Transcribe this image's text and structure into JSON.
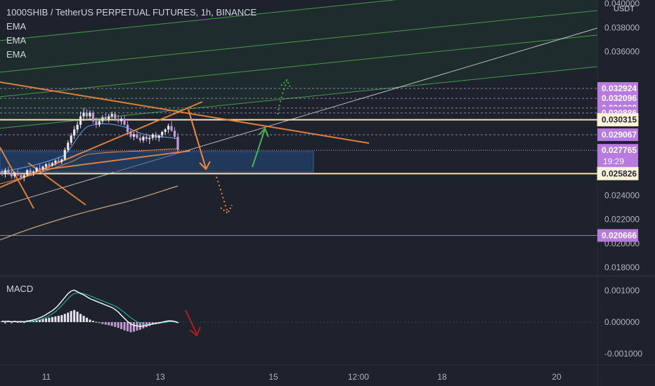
{
  "header": {
    "symbol_title": "1000SHIB / TetherUS PERPETUAL FUTURES, 1h, BINANCE",
    "indicators": [
      "EMA",
      "EMA",
      "EMA"
    ],
    "currency": "USDT"
  },
  "colors": {
    "background": "#1e222d",
    "up_candle": "#e8e8f0",
    "down_candle": "#c39bd3",
    "trendline": "#f0883e",
    "support_line": "#ffe0a6",
    "purple_label": "#b97ae0",
    "green_arrow": "#4caf50",
    "red_arrow": "#b71c1c",
    "zone_fill": "#234a80"
  },
  "chart_data": [
    {
      "type": "line",
      "title": "1000SHIB / TetherUS PERPETUAL FUTURES, 1h, BINANCE",
      "y_axis": {
        "ticks": [
          "0.040000",
          "0.038000",
          "0.036000",
          "0.024000",
          "0.022000",
          "0.020000",
          "0.018000"
        ],
        "range": [
          0.0173,
          0.0403
        ]
      },
      "x_axis": {
        "ticks": [
          "11",
          "13",
          "15",
          "12:00",
          "18",
          "20"
        ]
      },
      "price_labels": [
        {
          "value": "0.032924",
          "kind": "purple"
        },
        {
          "value": "0.032096",
          "kind": "purple"
        },
        {
          "value": "0.031292",
          "kind": "purple"
        },
        {
          "value": "0.030886",
          "kind": "purple"
        },
        {
          "value": "0.030315",
          "kind": "support"
        },
        {
          "value": "0.029067",
          "kind": "purple"
        },
        {
          "value": "0.027765",
          "countdown": "19:29",
          "kind": "current"
        },
        {
          "value": "0.025826",
          "kind": "support"
        },
        {
          "value": "0.020666",
          "kind": "purple"
        }
      ],
      "candles": [
        [
          0.026,
          0.0262,
          0.0256,
          0.0258
        ],
        [
          0.0258,
          0.0263,
          0.0255,
          0.0261
        ],
        [
          0.0261,
          0.0264,
          0.0257,
          0.0259
        ],
        [
          0.0259,
          0.0261,
          0.0254,
          0.0256
        ],
        [
          0.0256,
          0.026,
          0.0254,
          0.0259
        ],
        [
          0.0259,
          0.0262,
          0.0256,
          0.0257
        ],
        [
          0.0257,
          0.0259,
          0.0253,
          0.0255
        ],
        [
          0.0255,
          0.0258,
          0.0252,
          0.0257
        ],
        [
          0.0257,
          0.0262,
          0.0256,
          0.0261
        ],
        [
          0.0261,
          0.0263,
          0.0258,
          0.0259
        ],
        [
          0.0259,
          0.0261,
          0.0256,
          0.026
        ],
        [
          0.026,
          0.0264,
          0.0259,
          0.0263
        ],
        [
          0.0263,
          0.0266,
          0.0261,
          0.0262
        ],
        [
          0.0262,
          0.0265,
          0.026,
          0.0264
        ],
        [
          0.0264,
          0.0267,
          0.0262,
          0.0266
        ],
        [
          0.0266,
          0.0268,
          0.0263,
          0.0265
        ],
        [
          0.0265,
          0.0268,
          0.0264,
          0.0267
        ],
        [
          0.0267,
          0.027,
          0.0265,
          0.0269
        ],
        [
          0.0269,
          0.0272,
          0.0267,
          0.0268
        ],
        [
          0.0268,
          0.0271,
          0.0266,
          0.027
        ],
        [
          0.027,
          0.028,
          0.0269,
          0.0278
        ],
        [
          0.0278,
          0.0286,
          0.0276,
          0.0284
        ],
        [
          0.0284,
          0.0292,
          0.0282,
          0.029
        ],
        [
          0.029,
          0.0298,
          0.0287,
          0.0295
        ],
        [
          0.0295,
          0.0302,
          0.0292,
          0.0299
        ],
        [
          0.0299,
          0.031,
          0.0296,
          0.0306
        ],
        [
          0.0306,
          0.0313,
          0.0302,
          0.0309
        ],
        [
          0.0309,
          0.0312,
          0.0304,
          0.0306
        ],
        [
          0.0306,
          0.0311,
          0.0303,
          0.0309
        ],
        [
          0.0309,
          0.0311,
          0.03,
          0.0302
        ],
        [
          0.0302,
          0.0305,
          0.0296,
          0.0299
        ],
        [
          0.0299,
          0.0304,
          0.0297,
          0.0302
        ],
        [
          0.0302,
          0.0307,
          0.03,
          0.0305
        ],
        [
          0.0305,
          0.0309,
          0.0302,
          0.0303
        ],
        [
          0.0303,
          0.0308,
          0.0301,
          0.0306
        ],
        [
          0.0306,
          0.031,
          0.0304,
          0.0308
        ],
        [
          0.0308,
          0.031,
          0.0302,
          0.0304
        ],
        [
          0.0304,
          0.0307,
          0.03,
          0.0302
        ],
        [
          0.0302,
          0.0306,
          0.0299,
          0.0304
        ],
        [
          0.0304,
          0.0307,
          0.0298,
          0.0299
        ],
        [
          0.0299,
          0.0302,
          0.0291,
          0.0293
        ],
        [
          0.0293,
          0.0296,
          0.0287,
          0.0289
        ],
        [
          0.0289,
          0.0293,
          0.0286,
          0.0291
        ],
        [
          0.0291,
          0.0294,
          0.0287,
          0.0288
        ],
        [
          0.0288,
          0.0291,
          0.0284,
          0.0286
        ],
        [
          0.0286,
          0.029,
          0.0284,
          0.0289
        ],
        [
          0.0289,
          0.0292,
          0.0285,
          0.0287
        ],
        [
          0.0287,
          0.029,
          0.0283,
          0.0288
        ],
        [
          0.0288,
          0.0292,
          0.0286,
          0.0291
        ],
        [
          0.0291,
          0.0293,
          0.0286,
          0.0288
        ],
        [
          0.0288,
          0.0291,
          0.0285,
          0.029
        ],
        [
          0.029,
          0.0294,
          0.0288,
          0.0293
        ],
        [
          0.0293,
          0.0296,
          0.0291,
          0.0295
        ],
        [
          0.0295,
          0.03,
          0.0292,
          0.0298
        ],
        [
          0.0298,
          0.0302,
          0.0293,
          0.0294
        ],
        [
          0.0294,
          0.0297,
          0.0287,
          0.0289
        ],
        [
          0.0289,
          0.0292,
          0.0276,
          0.0278
        ]
      ],
      "macd": {
        "y_ticks": [
          "0.001000",
          "0.000000",
          "-0.001000"
        ],
        "range": [
          -0.00135,
          0.00135
        ],
        "histogram": [
          3e-05,
          -4e-05,
          2e-05,
          -3e-05,
          4e-05,
          -2e-05,
          1e-05,
          -3e-05,
          5e-05,
          4e-05,
          3e-05,
          6e-05,
          8e-05,
          0.0001,
          0.00012,
          0.00014,
          0.00016,
          0.00018,
          0.0002,
          0.00022,
          0.00026,
          0.0003,
          0.00035,
          0.00038,
          0.00033,
          0.00026,
          0.0002,
          0.00014,
          8e-05,
          4e-05,
          1e-05,
          -3e-05,
          -6e-05,
          -8e-05,
          -0.0001,
          -0.00012,
          -0.00015,
          -0.00018,
          -0.00022,
          -0.00026,
          -0.00029,
          -0.00032,
          -0.0003,
          -0.00027,
          -0.00024,
          -0.0002,
          -0.00016,
          -0.00012,
          -8e-05,
          -5e-05,
          -2e-05,
          1e-05,
          3e-05,
          5e-05,
          4e-05,
          2e-05,
          -3e-05
        ],
        "macd_line": [
          3e-05,
          2e-05,
          3e-05,
          1e-05,
          2e-05,
          1e-05,
          2e-05,
          1e-05,
          3e-05,
          5e-05,
          7e-05,
          0.0001,
          0.00014,
          0.00018,
          0.00024,
          0.0003,
          0.00036,
          0.00044,
          0.00054,
          0.00066,
          0.00078,
          0.0009,
          0.00098,
          0.00101,
          0.00096,
          0.0009,
          0.00086,
          0.0008,
          0.00074,
          0.0007,
          0.00066,
          0.00062,
          0.00058,
          0.00054,
          0.0005,
          0.00046,
          0.0004,
          0.00032,
          0.00022,
          0.00012,
          2e-05,
          -6e-05,
          -0.0001,
          -0.00012,
          -0.00013,
          -0.00012,
          -0.0001,
          -8e-05,
          -6e-05,
          -4e-05,
          -2e-05,
          0.0,
          2e-05,
          4e-05,
          4e-05,
          2e-05,
          -2e-05
        ],
        "signal_line": [
          2e-05,
          2e-05,
          2e-05,
          2e-05,
          2e-05,
          2e-05,
          2e-05,
          2e-05,
          2e-05,
          3e-05,
          4e-05,
          6e-05,
          8e-05,
          0.00011,
          0.00015,
          0.0002,
          0.00026,
          0.00033,
          0.00042,
          0.00052,
          0.00063,
          0.00074,
          0.00084,
          0.0009,
          0.00092,
          0.00092,
          0.0009,
          0.00087,
          0.00083,
          0.00079,
          0.00075,
          0.00071,
          0.00067,
          0.00063,
          0.00059,
          0.00055,
          0.0005,
          0.00045,
          0.00038,
          0.0003,
          0.00022,
          0.00014,
          7e-05,
          1e-05,
          -3e-05,
          -6e-05,
          -7e-05,
          -7e-05,
          -6e-05,
          -5e-05,
          -4e-05,
          -2e-05,
          -1e-05,
          1e-05,
          2e-05,
          2e-05,
          1e-05
        ]
      }
    }
  ]
}
